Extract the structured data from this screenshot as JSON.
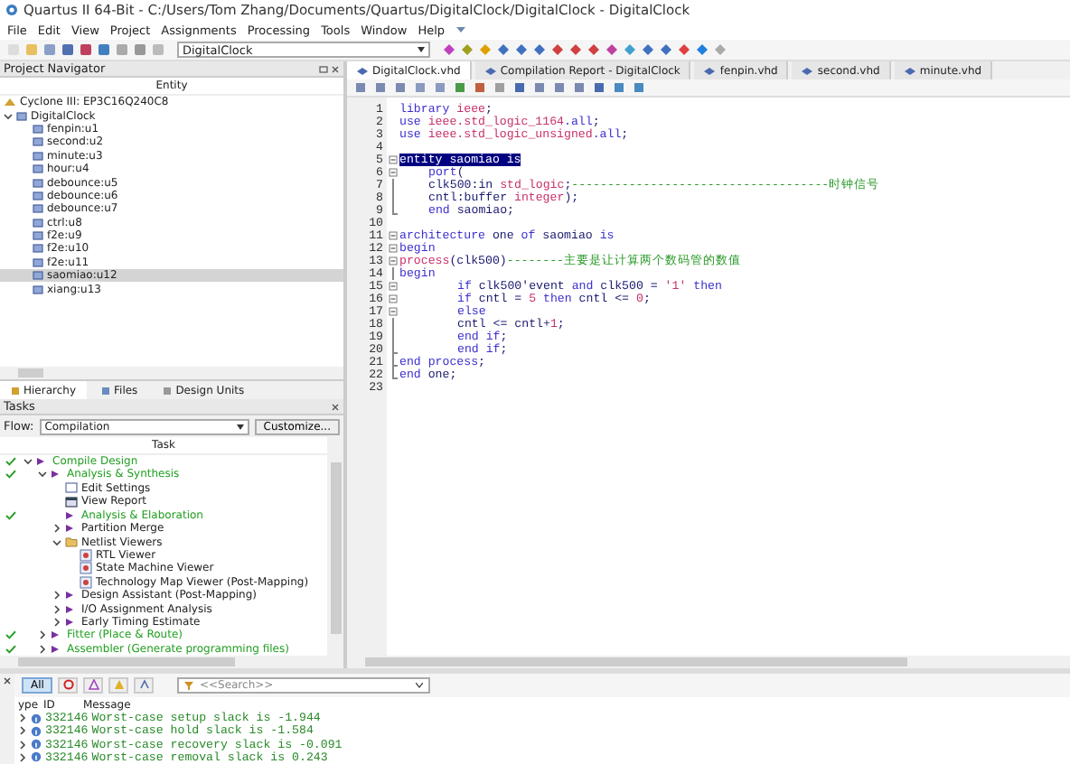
{
  "window": {
    "title": "Quartus II 64-Bit - C:/Users/Tom Zhang/Documents/Quartus/DigitalClock/DigitalClock - DigitalClock"
  },
  "menu": [
    "File",
    "Edit",
    "View",
    "Project",
    "Assignments",
    "Processing",
    "Tools",
    "Window",
    "Help"
  ],
  "toolbar": {
    "project": "DigitalClock"
  },
  "navigator": {
    "title": "Project Navigator",
    "column": "Entity",
    "device": "Cyclone III: EP3C16Q240C8",
    "root": {
      "label": "DigitalClock",
      "expanded": true,
      "children": [
        {
          "label": "fenpin:u1",
          "selected": false
        },
        {
          "label": "second:u2",
          "selected": false
        },
        {
          "label": "minute:u3",
          "selected": false
        },
        {
          "label": "hour:u4",
          "selected": false
        },
        {
          "label": "debounce:u5",
          "selected": false
        },
        {
          "label": "debounce:u6",
          "selected": false
        },
        {
          "label": "debounce:u7",
          "selected": false
        },
        {
          "label": "ctrl:u8",
          "selected": false
        },
        {
          "label": "f2e:u9",
          "selected": false
        },
        {
          "label": "f2e:u10",
          "selected": false
        },
        {
          "label": "f2e:u11",
          "selected": false
        },
        {
          "label": "saomiao:u12",
          "selected": true
        },
        {
          "label": "xiang:u13",
          "selected": false
        }
      ]
    },
    "tabs": [
      {
        "label": "Hierarchy",
        "selected": true
      },
      {
        "label": "Files",
        "selected": false
      },
      {
        "label": "Design Units",
        "selected": false
      }
    ]
  },
  "tasks": {
    "title": "Tasks",
    "flow_label": "Flow:",
    "flow": "Compilation",
    "customize": "Customize...",
    "column": "Task",
    "rows": [
      {
        "label": "Compile Design",
        "kind": "flow",
        "done": true,
        "expanded": true,
        "children": [
          {
            "label": "Analysis & Synthesis",
            "kind": "flow",
            "done": true,
            "expanded": true,
            "children": [
              {
                "label": "Edit Settings",
                "kind": "settings",
                "done": false
              },
              {
                "label": "View Report",
                "kind": "report",
                "done": false
              },
              {
                "label": "Analysis & Elaboration",
                "kind": "flow",
                "done": true
              },
              {
                "label": "Partition Merge",
                "kind": "flow",
                "done": false,
                "expanded": false
              },
              {
                "label": "Netlist Viewers",
                "kind": "folder",
                "done": false,
                "expanded": true,
                "children": [
                  {
                    "label": "RTL Viewer",
                    "kind": "viewer",
                    "done": false
                  },
                  {
                    "label": "State Machine Viewer",
                    "kind": "viewer",
                    "done": false
                  },
                  {
                    "label": "Technology Map Viewer (Post-Mapping)",
                    "kind": "viewer",
                    "done": false
                  }
                ]
              },
              {
                "label": "Design Assistant (Post-Mapping)",
                "kind": "flow",
                "done": false,
                "expanded": false
              },
              {
                "label": "I/O Assignment Analysis",
                "kind": "flow",
                "done": false,
                "expanded": false
              },
              {
                "label": "Early Timing Estimate",
                "kind": "flow",
                "done": false,
                "expanded": false
              }
            ]
          },
          {
            "label": "Fitter (Place & Route)",
            "kind": "flow",
            "done": true,
            "expanded": false
          },
          {
            "label": "Assembler (Generate programming files)",
            "kind": "flow",
            "done": true,
            "expanded": false
          }
        ]
      }
    ]
  },
  "editor": {
    "tabs": [
      {
        "label": "DigitalClock.vhd",
        "selected": true
      },
      {
        "label": "Compilation Report - DigitalClock",
        "selected": false
      },
      {
        "label": "fenpin.vhd",
        "selected": false
      },
      {
        "label": "second.vhd",
        "selected": false
      },
      {
        "label": "minute.vhd",
        "selected": false
      }
    ],
    "lines": [
      {
        "n": "1",
        "kind": "top",
        "tokens": [
          {
            "kind": "keyword",
            "t": "library "
          },
          {
            "kind": "library",
            "t": "ieee"
          },
          {
            "kind": "plain",
            "t": ";"
          }
        ]
      },
      {
        "n": "2",
        "kind": "top",
        "tokens": [
          {
            "kind": "keyword",
            "t": "use "
          },
          {
            "kind": "library",
            "t": "ieee.std_logic_1164"
          },
          {
            "kind": "keyword",
            "t": ".all"
          },
          {
            "kind": "plain",
            "t": ";"
          }
        ]
      },
      {
        "n": "3",
        "kind": "top",
        "tokens": [
          {
            "kind": "keyword",
            "t": "use "
          },
          {
            "kind": "library",
            "t": "ieee.std_logic_unsigned"
          },
          {
            "kind": "keyword",
            "t": ".all"
          },
          {
            "kind": "plain",
            "t": ";"
          }
        ]
      },
      {
        "n": "4"
      },
      {
        "n": "5",
        "kind": "top",
        "fold": {
          "kind": "start"
        },
        "selected": true,
        "tokens": [
          {
            "t": "entity saomiao is"
          }
        ]
      },
      {
        "n": "6",
        "kind": "body",
        "fold": {
          "kind": "start"
        },
        "selected": false,
        "tokens": [
          {
            "kind": "keyword",
            "t": "port"
          },
          {
            "kind": "plain",
            "t": "("
          }
        ]
      },
      {
        "n": "7",
        "kind": "body",
        "fold": {
          "kind": "line"
        },
        "tokens": [
          {
            "kind": "plain",
            "t": "clk500:in "
          },
          {
            "kind": "library",
            "t": "std_logic"
          },
          {
            "kind": "plain",
            "t": ";"
          },
          {
            "kind": "comment",
            "t": "------------------------------------时钟信号"
          }
        ]
      },
      {
        "n": "8",
        "kind": "body",
        "fold": {
          "kind": "line"
        },
        "tokens": [
          {
            "kind": "plain",
            "t": "cntl:buffer "
          },
          {
            "kind": "library",
            "t": "integer"
          },
          {
            "kind": "plain",
            "t": ");"
          }
        ]
      },
      {
        "n": "9",
        "kind": "body",
        "fold": {
          "kind": "end"
        },
        "tokens": [
          {
            "kind": "keyword",
            "t": "end"
          },
          {
            "kind": "plain",
            "t": " saomiao;"
          }
        ]
      },
      {
        "n": "10"
      },
      {
        "n": "11",
        "kind": "top",
        "fold": {
          "kind": "start"
        },
        "selected": false,
        "tokens": [
          {
            "kind": "keyword",
            "t": "architecture"
          },
          {
            "kind": "plain",
            "t": " one "
          },
          {
            "kind": "keyword",
            "t": "of"
          },
          {
            "kind": "plain",
            "t": " saomiao "
          },
          {
            "kind": "keyword",
            "t": "is"
          }
        ]
      },
      {
        "n": "12",
        "kind": "top",
        "fold": {
          "kind": "start"
        },
        "selected": false,
        "tokens": [
          {
            "kind": "keyword",
            "t": "begin"
          }
        ]
      },
      {
        "n": "13",
        "kind": "top",
        "fold": {
          "kind": "start"
        },
        "selected": false,
        "tokens": [
          {
            "kind": "library",
            "t": "process"
          },
          {
            "kind": "plain",
            "t": "(clk500)"
          },
          {
            "kind": "comment",
            "t": "--------主要是让计算两个数码管的数值"
          }
        ]
      },
      {
        "n": "14",
        "kind": "top",
        "fold": {
          "kind": "line"
        },
        "tokens": [
          {
            "kind": "keyword",
            "t": "begin"
          }
        ]
      },
      {
        "n": "15",
        "kind": "nested",
        "fold": {
          "kind": "start"
        },
        "selected": false,
        "tokens": [
          {
            "kind": "keyword",
            "t": "if"
          },
          {
            "kind": "plain",
            "t": " clk500'event "
          },
          {
            "kind": "keyword",
            "t": "and"
          },
          {
            "kind": "plain",
            "t": " clk500 = "
          },
          {
            "kind": "library",
            "t": "'1'"
          },
          {
            "kind": "keyword",
            "t": " then"
          }
        ]
      },
      {
        "n": "16",
        "kind": "nested",
        "fold": {
          "kind": "start"
        },
        "selected": false,
        "tokens": [
          {
            "kind": "keyword",
            "t": "if"
          },
          {
            "kind": "plain",
            "t": " cntl = "
          },
          {
            "kind": "library",
            "t": "5"
          },
          {
            "kind": "keyword",
            "t": " then"
          },
          {
            "kind": "plain",
            "t": " cntl <= "
          },
          {
            "kind": "library",
            "t": "0"
          },
          {
            "kind": "plain",
            "t": ";"
          }
        ]
      },
      {
        "n": "17",
        "kind": "nested",
        "fold": {
          "kind": "start"
        },
        "selected": false,
        "tokens": [
          {
            "kind": "keyword",
            "t": "else"
          }
        ]
      },
      {
        "n": "18",
        "kind": "nested",
        "fold": {
          "kind": "line"
        },
        "tokens": [
          {
            "kind": "plain",
            "t": "cntl <= cntl+"
          },
          {
            "kind": "library",
            "t": "1"
          },
          {
            "kind": "plain",
            "t": ";"
          }
        ]
      },
      {
        "n": "19",
        "kind": "nested",
        "fold": {
          "kind": "line"
        },
        "tokens": [
          {
            "kind": "keyword",
            "t": "end if"
          },
          {
            "kind": "plain",
            "t": ";"
          }
        ]
      },
      {
        "n": "20",
        "kind": "nested",
        "fold": {
          "kind": "end"
        },
        "tokens": [
          {
            "kind": "keyword",
            "t": "end if"
          },
          {
            "kind": "plain",
            "t": ";"
          }
        ]
      },
      {
        "n": "21",
        "kind": "top",
        "fold": {
          "kind": "end"
        },
        "tokens": [
          {
            "kind": "keyword",
            "t": "end process"
          },
          {
            "kind": "plain",
            "t": ";"
          }
        ]
      },
      {
        "n": "22",
        "kind": "top",
        "fold": {
          "kind": "end"
        },
        "tokens": [
          {
            "kind": "keyword",
            "t": "end"
          },
          {
            "kind": "plain",
            "t": " one;"
          }
        ]
      },
      {
        "n": "23"
      }
    ]
  },
  "messages": {
    "filters": [
      {
        "label": "All",
        "selected": true
      }
    ],
    "search_placeholder": "<<Search>>",
    "columns": [
      "ype",
      "ID",
      "Message"
    ],
    "rows": [
      {
        "id": "332146",
        "message": "Worst-case setup slack is -1.944"
      },
      {
        "id": "332146",
        "message": "Worst-case hold slack is -1.584"
      },
      {
        "id": "332146",
        "message": "Worst-case recovery slack is -0.091"
      },
      {
        "id": "332146",
        "message": "Worst-case removal slack is 0.243"
      }
    ]
  }
}
